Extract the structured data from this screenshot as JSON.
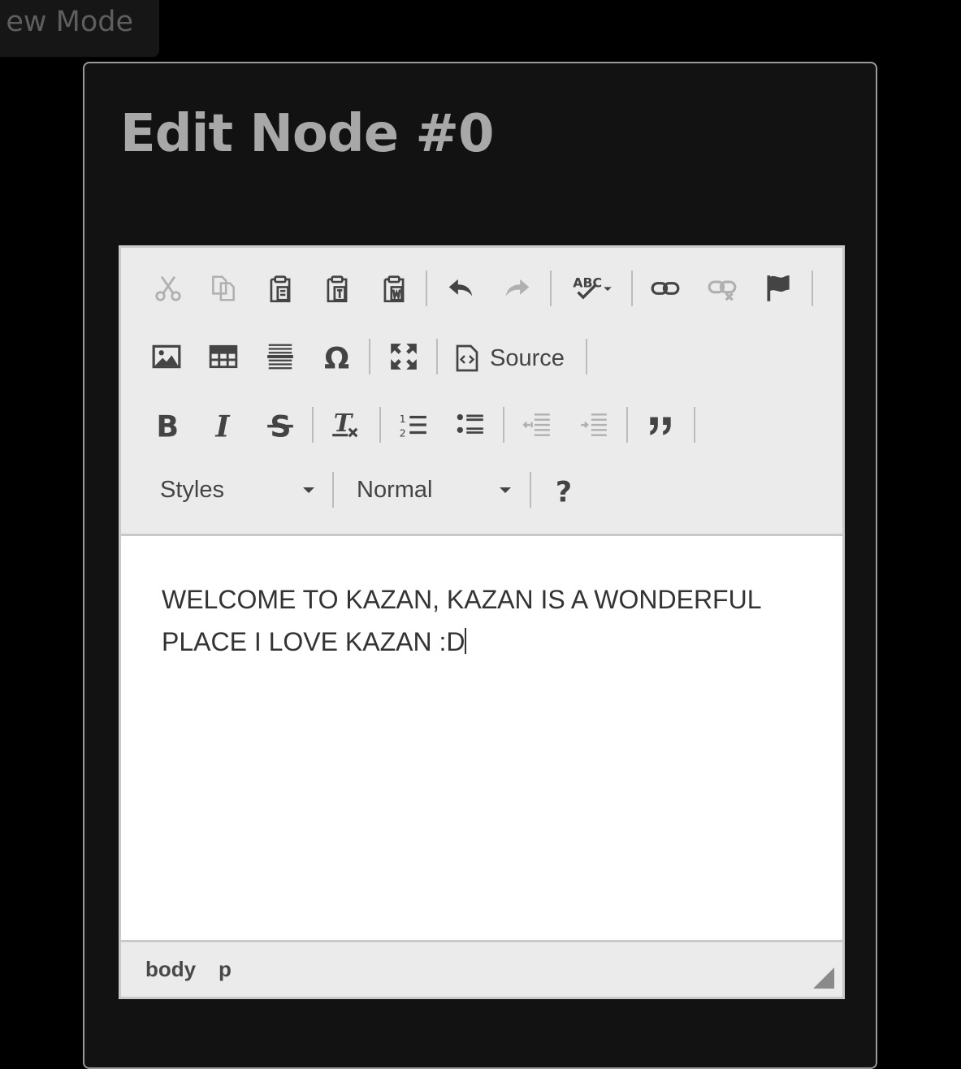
{
  "mode_button": {
    "label": "ew Mode"
  },
  "dialog": {
    "title": "Edit Node #0"
  },
  "toolbar": {
    "source_label": "Source",
    "styles_combo": {
      "value": "Styles"
    },
    "format_combo": {
      "value": "Normal"
    }
  },
  "editor": {
    "text": "WELCOME TO KAZAN, KAZAN IS A WONDERFUL PLACE I LOVE KAZAN :D"
  },
  "element_path": {
    "items": [
      "body",
      "p"
    ]
  },
  "colors": {
    "background": "#000000",
    "dialog_bg": "#121212",
    "toolbar_bg": "#ebebeb",
    "icon_active": "#444444",
    "icon_disabled": "#b0b0b0"
  }
}
